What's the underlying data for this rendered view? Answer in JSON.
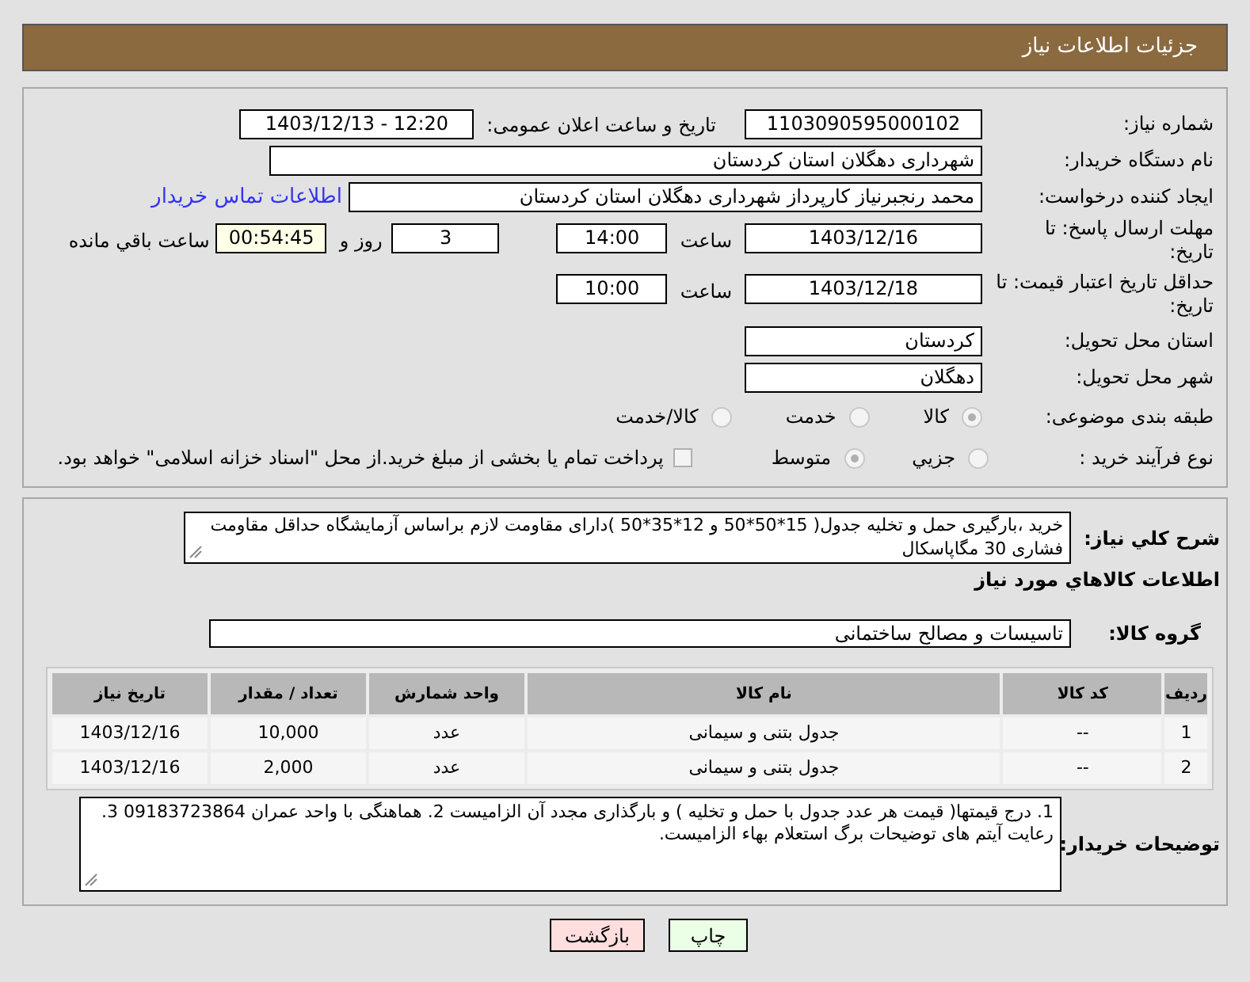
{
  "header": {
    "title": "جزئیات اطلاعات نیاز"
  },
  "need_number": {
    "label": "شماره نیاز:",
    "value": "1103090595000102"
  },
  "announcement": {
    "label": "تاریخ و ساعت اعلان عمومی:",
    "value": "1403/12/13 - 12:20"
  },
  "buyer_org": {
    "label": "نام دستگاه خریدار:",
    "value": "شهرداری دهگلان استان کردستان"
  },
  "requester": {
    "label": "ایجاد کننده درخواست:",
    "value": "محمد رنجبرنیاز کارپرداز شهرداری دهگلان استان کردستان",
    "link": "اطلاعات تماس خریدار"
  },
  "reply_deadline": {
    "label": "مهلت ارسال پاسخ: تا تاریخ:",
    "date": "1403/12/16",
    "time_label": "ساعت",
    "time": "14:00",
    "days": "3",
    "days_label": "روز و",
    "remaining": "00:54:45",
    "remaining_label": "ساعت باقي مانده"
  },
  "price_validity": {
    "label": "حداقل تاریخ اعتبار قیمت: تا تاریخ:",
    "date": "1403/12/18",
    "time_label": "ساعت",
    "time": "10:00"
  },
  "province": {
    "label": "استان محل تحویل:",
    "value": "کردستان"
  },
  "city": {
    "label": "شهر محل تحویل:",
    "value": "دهگلان"
  },
  "category": {
    "label": "طبقه بندی موضوعی:",
    "options": [
      {
        "label": "کالا",
        "selected": true
      },
      {
        "label": "خدمت",
        "selected": false
      },
      {
        "label": "کالا/خدمت",
        "selected": false
      }
    ]
  },
  "purchase_type": {
    "label": "نوع فرآیند خرید :",
    "options": [
      {
        "label": "جزیي",
        "selected": false
      },
      {
        "label": "متوسط",
        "selected": true
      }
    ],
    "treasury": {
      "checked": false,
      "label": "پرداخت تمام یا بخشی از مبلغ خرید.از محل \"اسناد خزانه اسلامی\" خواهد بود."
    }
  },
  "description": {
    "label": "شرح کلي نیاز:",
    "value": "خرید ،بارگیری حمل و تخلیه جدول(  15*50*50 و  12*35*50 )دارای مقاومت لازم براساس آزمایشگاه حداقل مقاومت فشاری 30 مگاپاسکال"
  },
  "goods_heading": "اطلاعات کالاهاي مورد نیاز",
  "goods_group": {
    "label": "گروه کالا:",
    "value": "تاسیسات و مصالح ساختمانی"
  },
  "table": {
    "columns": [
      "ردیف",
      "کد کالا",
      "نام کالا",
      "واحد شمارش",
      "تعداد / مقدار",
      "تاریخ نیاز"
    ],
    "rows": [
      [
        "1",
        "--",
        "جدول بتنی و سیمانی",
        "عدد",
        "10,000",
        "1403/12/16"
      ],
      [
        "2",
        "--",
        "جدول بتنی و سیمانی",
        "عدد",
        "2,000",
        "1403/12/16"
      ]
    ]
  },
  "buyer_notes": {
    "label": "توضیحات خریدار:",
    "value": "1. درج قیمتها( قیمت هر عدد جدول با حمل و تخلیه ) و بارگذاری مجدد آن الزامیست 2. هماهنگی با واحد عمران 09183723864  3. رعایت آیتم های توضیحات برگ استعلام بهاء الزامیست."
  },
  "buttons": [
    {
      "kind": "print",
      "label": "چاپ"
    },
    {
      "kind": "back",
      "label": "بازگشت"
    }
  ]
}
